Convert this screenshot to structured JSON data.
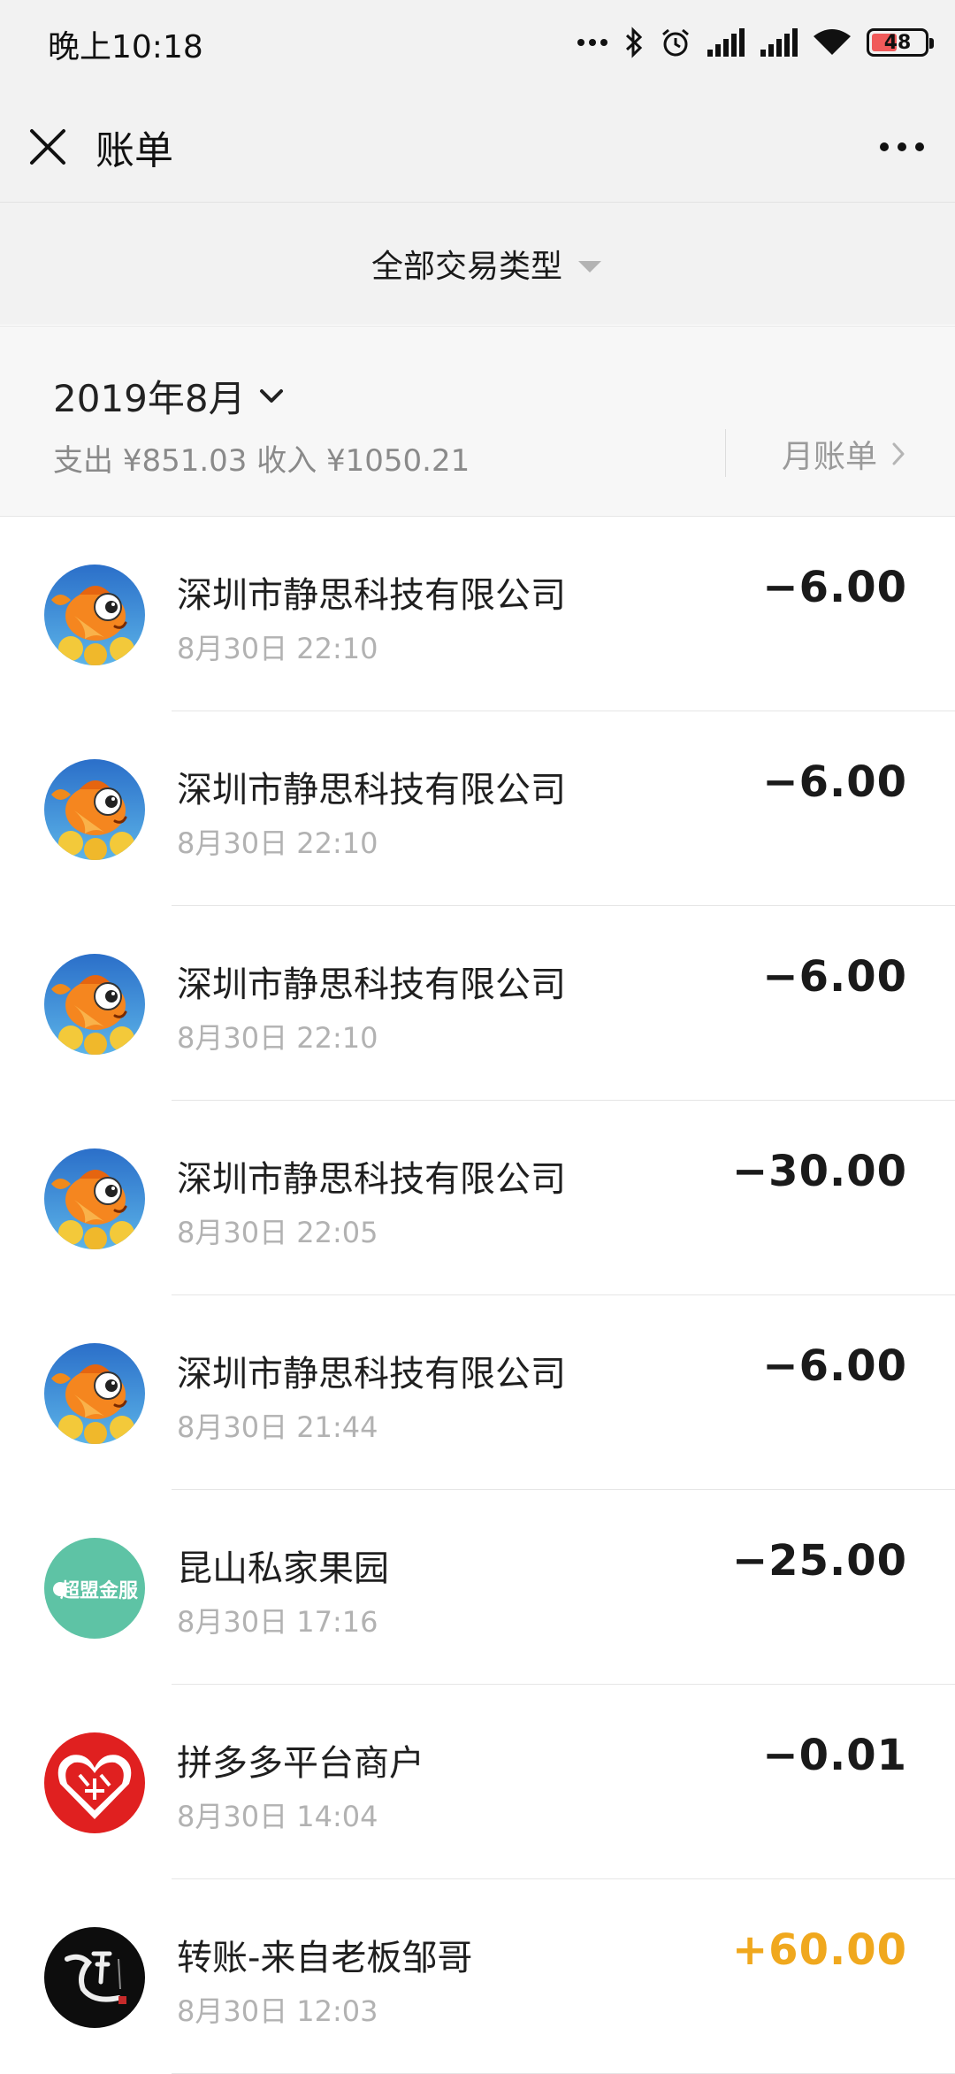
{
  "status_bar": {
    "time": "晚上10:18",
    "battery": "48",
    "battery_level": 0.48,
    "icons": [
      "more-dots-icon",
      "bluetooth-icon",
      "alarm-icon",
      "signal-icon",
      "signal-icon",
      "wifi-icon",
      "battery-icon"
    ]
  },
  "nav": {
    "title": "账单",
    "close_icon": "close-icon",
    "more_icon": "more-icon"
  },
  "filter": {
    "label": "全部交易类型"
  },
  "month": {
    "title": "2019年8月",
    "summary": "支出 ¥851.03 收入 ¥1050.21",
    "monthly_bill": "月账单"
  },
  "transactions": [
    {
      "name": "深圳市静思科技有限公司",
      "time": "8月30日 22:10",
      "amount": "−6.00",
      "avatar": "fish-app-logo"
    },
    {
      "name": "深圳市静思科技有限公司",
      "time": "8月30日 22:10",
      "amount": "−6.00",
      "avatar": "fish-app-logo"
    },
    {
      "name": "深圳市静思科技有限公司",
      "time": "8月30日 22:10",
      "amount": "−6.00",
      "avatar": "fish-app-logo"
    },
    {
      "name": "深圳市静思科技有限公司",
      "time": "8月30日 22:05",
      "amount": "−30.00",
      "avatar": "fish-app-logo"
    },
    {
      "name": "深圳市静思科技有限公司",
      "time": "8月30日 21:44",
      "amount": "−6.00",
      "avatar": "fish-app-logo"
    },
    {
      "name": "昆山私家果园",
      "time": "8月30日 17:16",
      "amount": "−25.00",
      "avatar": "green-circle-logo",
      "avatar_text": "超盟金服"
    },
    {
      "name": "拼多多平台商户",
      "time": "8月30日 14:04",
      "amount": "−0.01",
      "avatar": "pinduoduo-logo"
    },
    {
      "name": "转账-来自老板邹哥",
      "time": "8月30日 12:03",
      "amount": "+60.00",
      "avatar": "calligraphy-avatar"
    }
  ],
  "colors": {
    "income": "#f0a81e",
    "expense": "#1a1a1a",
    "header_bg": "#f2f2f2"
  }
}
